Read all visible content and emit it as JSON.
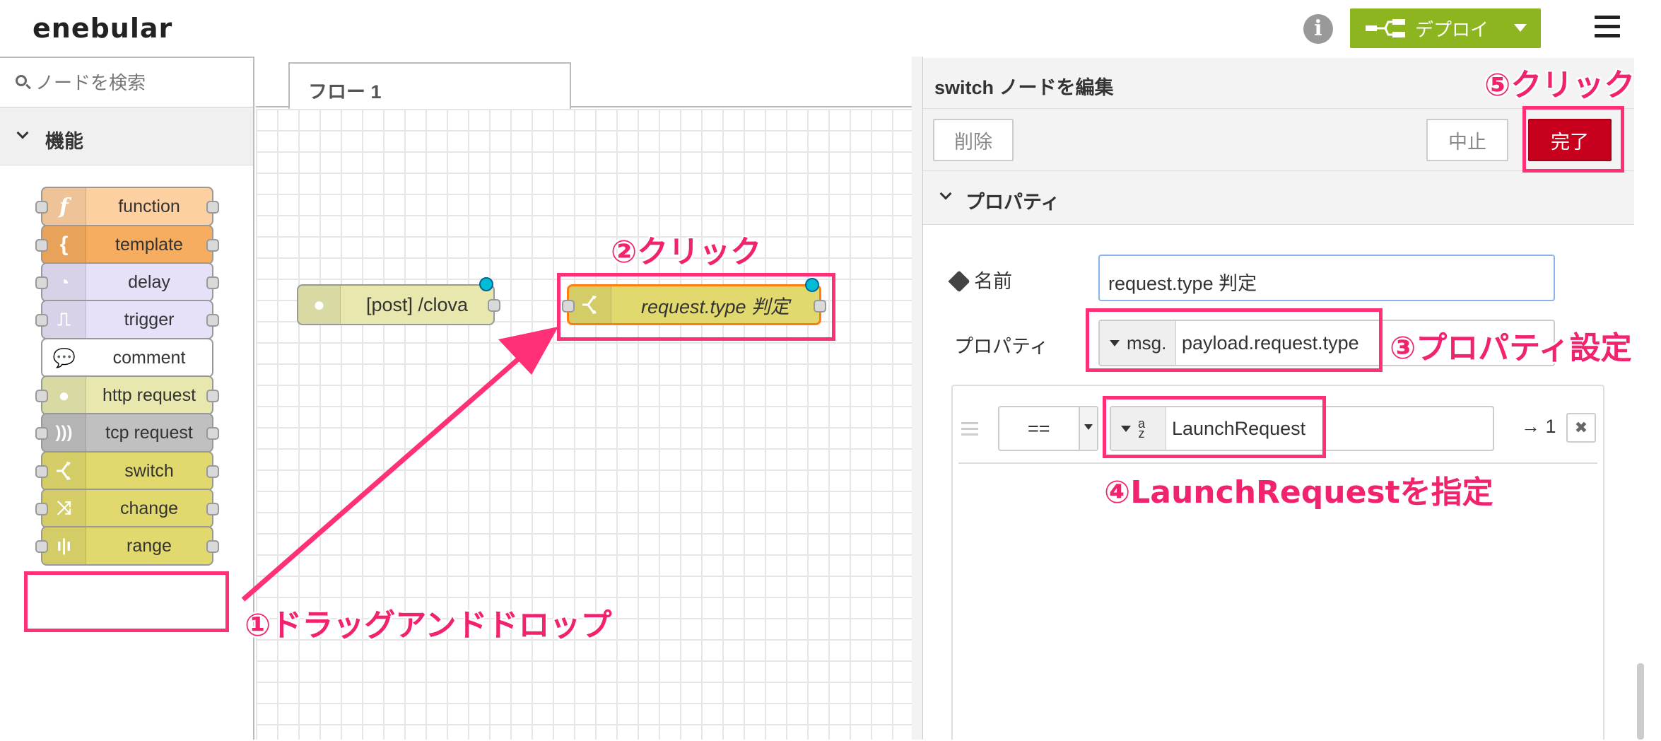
{
  "header": {
    "logo": "enebular",
    "deploy_label": "デプロイ"
  },
  "palette": {
    "search_placeholder": "ノードを検索",
    "category": "機能",
    "nodes": [
      {
        "label": "function",
        "color": "#fdd0a2"
      },
      {
        "label": "template",
        "color": "#f7ad60"
      },
      {
        "label": "delay",
        "color": "#e6e0f8"
      },
      {
        "label": "trigger",
        "color": "#e6e0f8"
      },
      {
        "label": "comment",
        "color": "#ffffff"
      },
      {
        "label": "http request",
        "color": "#e7e7ae"
      },
      {
        "label": "tcp request",
        "color": "#c0c0c0"
      },
      {
        "label": "switch",
        "color": "#e2d96e"
      },
      {
        "label": "change",
        "color": "#e2d96e"
      },
      {
        "label": "range",
        "color": "#e2d96e"
      }
    ]
  },
  "workspace": {
    "tab": "フロー 1",
    "nodes": {
      "http_in": "[post] /clova",
      "switch": "request.type 判定"
    }
  },
  "editor": {
    "title": "switch ノードを編集",
    "delete_label": "削除",
    "cancel_label": "中止",
    "done_label": "完了",
    "section": "プロパティ",
    "name_label": "名前",
    "name_value": "request.type 判定",
    "property_label": "プロパティ",
    "property_type": "msg.",
    "property_value": "payload.request.type",
    "rule": {
      "operator": "==",
      "value_type_top": "a",
      "value_type_bottom": "z",
      "value": "LaunchRequest",
      "output": "→ 1",
      "delete": "✖"
    }
  },
  "annotations": {
    "step1": "①ドラッグアンドドロップ",
    "step2": "②クリック",
    "step3": "③プロパティ設定",
    "step4": "④LaunchRequestを指定",
    "step5": "⑤クリック",
    "color": "#f2236e"
  }
}
